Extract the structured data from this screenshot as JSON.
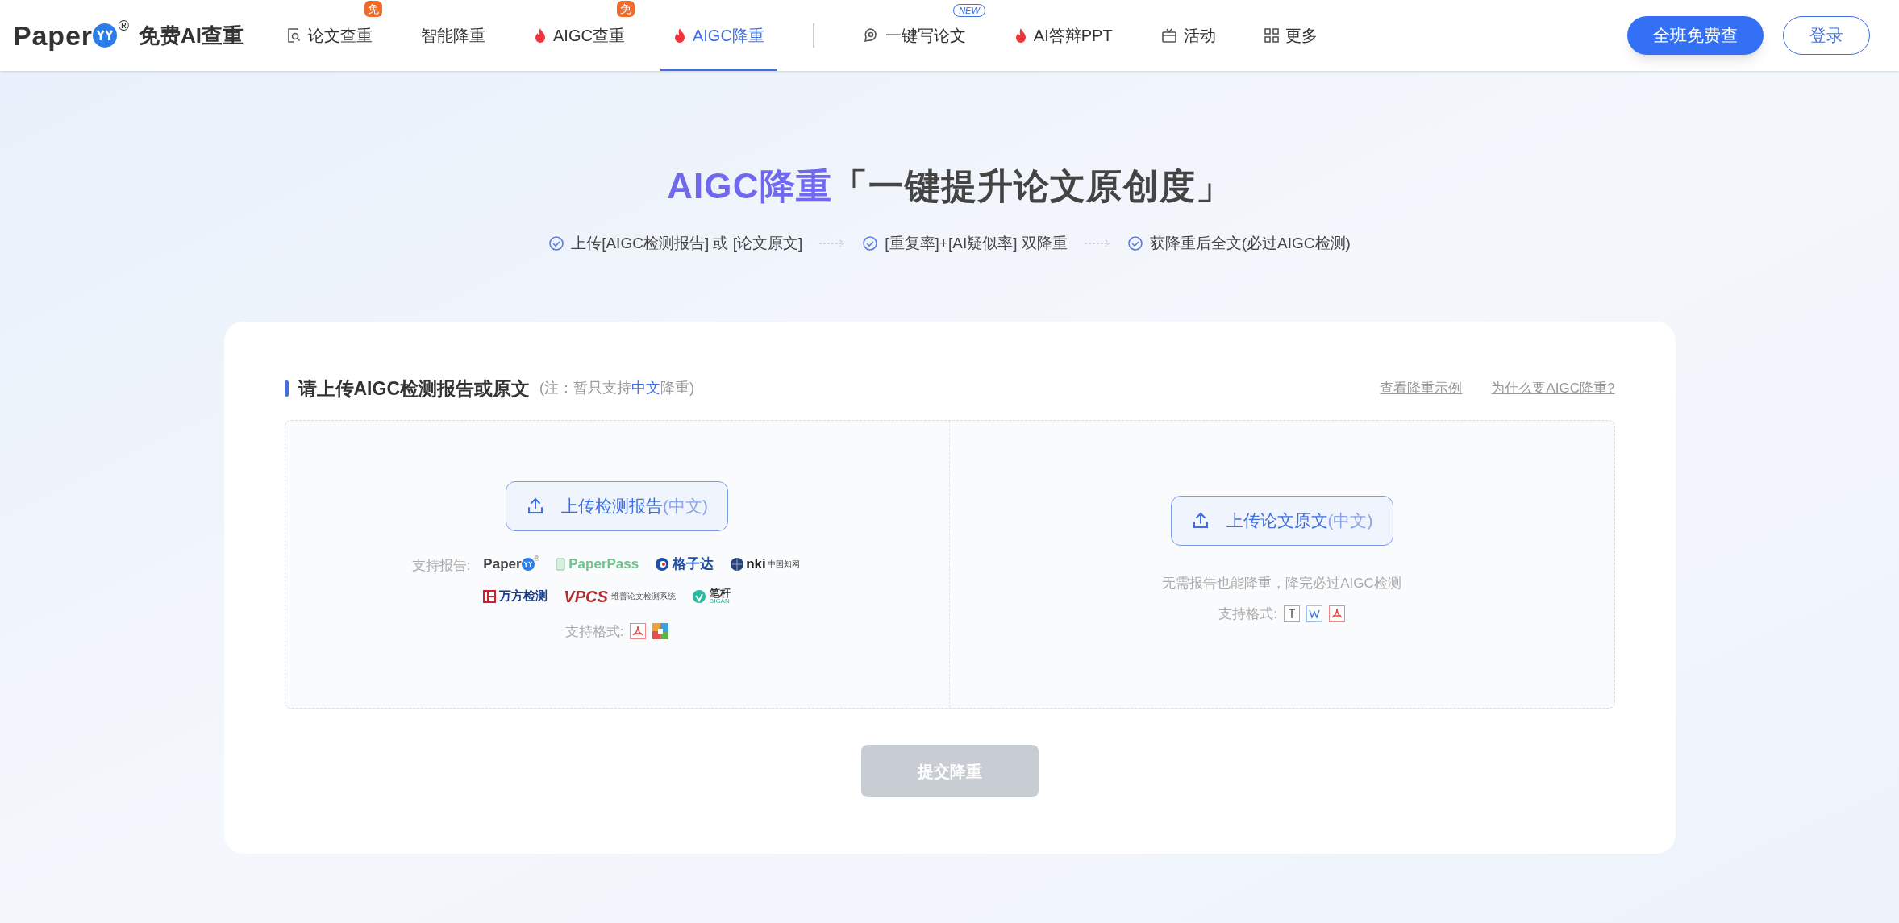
{
  "logo": {
    "text": "Paper",
    "registered": "®",
    "tagline": "免费AI查重"
  },
  "nav": [
    {
      "label": "论文查重",
      "kind": "doc-search",
      "badge": "免",
      "selected": false
    },
    {
      "label": "智能降重",
      "kind": "plain",
      "selected": false
    },
    {
      "label": "AIGC查重",
      "kind": "flame",
      "badge": "免",
      "selected": false
    },
    {
      "label": "AIGC降重",
      "kind": "flame",
      "selected": true
    },
    {
      "label": "一键写论文",
      "kind": "pen",
      "badge": "NEW",
      "selected": false,
      "divider_before": true
    },
    {
      "label": "AI答辩PPT",
      "kind": "flame",
      "selected": false
    },
    {
      "label": "活动",
      "kind": "gift",
      "selected": false
    },
    {
      "label": "更多",
      "kind": "grid",
      "selected": false
    }
  ],
  "header_buttons": {
    "primary": "全班免费查",
    "login": "登录"
  },
  "hero": {
    "title_accent": "AIGC降重",
    "title_rest": "「一键提升论文原创度」",
    "steps": [
      "上传[AIGC检测报告] 或 [论文原文]",
      "[重复率]+[AI疑似率] 双降重",
      "获降重后全文(必过AIGC检测)"
    ]
  },
  "card": {
    "heading": "请上传AIGC检测报告或原文",
    "note_before": "(注：暂只支持",
    "note_highlight": "中文",
    "note_after": "降重)",
    "links": [
      "查看降重示例",
      "为什么要AIGC降重?"
    ],
    "left": {
      "button": "上传检测报告",
      "button_suffix": "(中文)",
      "reports_label": "支持报告:",
      "reports": [
        {
          "kind": "paperyy",
          "text": "Paper",
          "sub": "®"
        },
        {
          "kind": "paperpass",
          "text": "PaperPass"
        },
        {
          "kind": "gezida",
          "text": "格子达"
        },
        {
          "kind": "cnki",
          "text": "nki",
          "sub": "中国知网"
        },
        {
          "kind": "wanfang",
          "text": "万方检测"
        },
        {
          "kind": "vpcs",
          "text": "VPCS",
          "sub": "维普论文检测系统"
        },
        {
          "kind": "bigan",
          "text": "笔杆",
          "sub": "BIGAN"
        }
      ],
      "formats_label": "支持格式:",
      "formats": [
        {
          "kind": "pdf"
        },
        {
          "kind": "zip"
        }
      ]
    },
    "right": {
      "button": "上传论文原文",
      "button_suffix": "(中文)",
      "hint": "无需报告也能降重，降完必过AIGC检测",
      "formats_label": "支持格式:",
      "formats": [
        {
          "kind": "txt"
        },
        {
          "kind": "word"
        },
        {
          "kind": "pdf"
        }
      ]
    },
    "submit": {
      "label": "提交降重",
      "disabled": true
    }
  }
}
